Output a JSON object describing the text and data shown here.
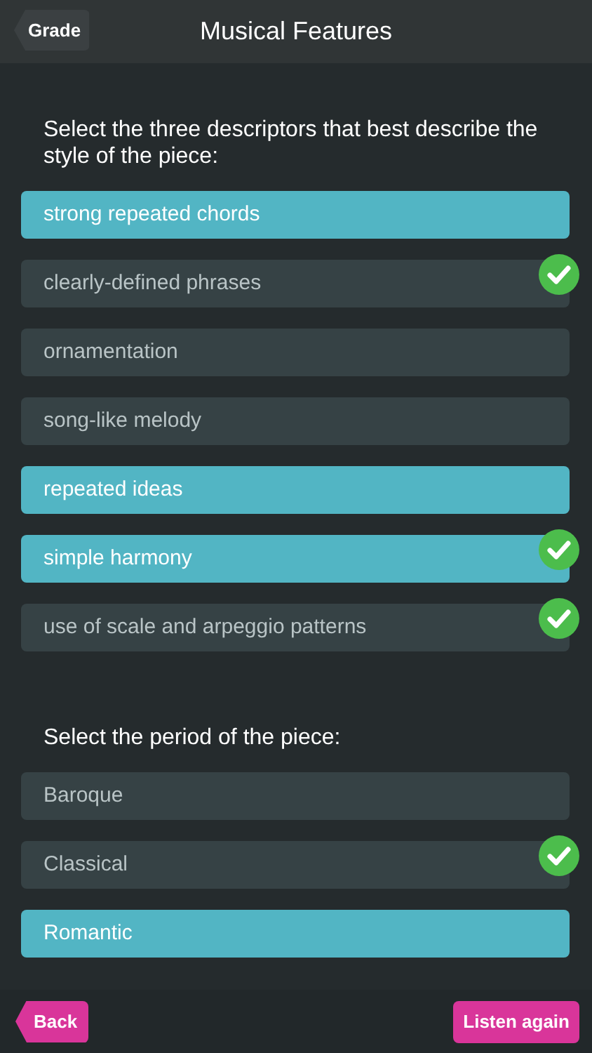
{
  "header": {
    "back_label": "Grade",
    "title": "Musical Features"
  },
  "questions": [
    {
      "prompt": "Select the three descriptors that best describe the style of the piece:",
      "options": [
        {
          "label": "strong repeated chords",
          "selected": true,
          "correct": false
        },
        {
          "label": "clearly-defined phrases",
          "selected": false,
          "correct": true
        },
        {
          "label": "ornamentation",
          "selected": false,
          "correct": false
        },
        {
          "label": "song-like melody",
          "selected": false,
          "correct": false
        },
        {
          "label": "repeated ideas",
          "selected": true,
          "correct": false
        },
        {
          "label": "simple harmony",
          "selected": true,
          "correct": true
        },
        {
          "label": "use of scale and arpeggio patterns",
          "selected": false,
          "correct": true
        }
      ]
    },
    {
      "prompt": "Select the period of the piece:",
      "options": [
        {
          "label": "Baroque",
          "selected": false,
          "correct": false
        },
        {
          "label": "Classical",
          "selected": false,
          "correct": true
        },
        {
          "label": "Romantic",
          "selected": true,
          "correct": false
        }
      ]
    }
  ],
  "footer": {
    "back_label": "Back",
    "listen_label": "Listen again"
  }
}
